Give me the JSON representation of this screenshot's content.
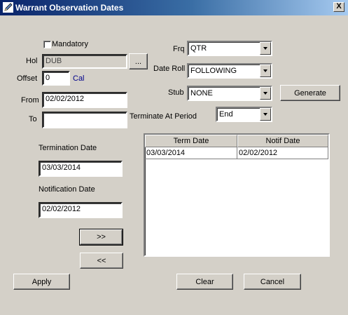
{
  "window": {
    "title": "Warrant Observation Dates",
    "close_label": "X"
  },
  "mandatory": {
    "label": "Mandatory",
    "checked": false
  },
  "hol": {
    "label": "Hol",
    "value": "DUB",
    "browse_label": "..."
  },
  "offset": {
    "label": "Offset",
    "value": "0",
    "cal_label": "Cal"
  },
  "from": {
    "label": "From",
    "value": "02/02/2012"
  },
  "to": {
    "label": "To",
    "value": ""
  },
  "frq": {
    "label": "Frq",
    "value": "QTR"
  },
  "date_roll": {
    "label": "Date Roll",
    "value": "FOLLOWING"
  },
  "stub": {
    "label": "Stub",
    "value": "NONE"
  },
  "terminate_at_period": {
    "label": "Terminate At Period",
    "value": "End"
  },
  "generate_label": "Generate",
  "termination_date": {
    "label": "Termination Date",
    "value": "03/03/2014"
  },
  "notification_date": {
    "label": "Notification Date",
    "value": "02/02/2012"
  },
  "add_label": ">>",
  "remove_label": "<<",
  "table": {
    "columns": [
      "Term Date",
      "Notif Date"
    ],
    "rows": [
      [
        "03/03/2014",
        "02/02/2012"
      ]
    ]
  },
  "footer": {
    "apply_label": "Apply",
    "clear_label": "Clear",
    "cancel_label": "Cancel"
  }
}
